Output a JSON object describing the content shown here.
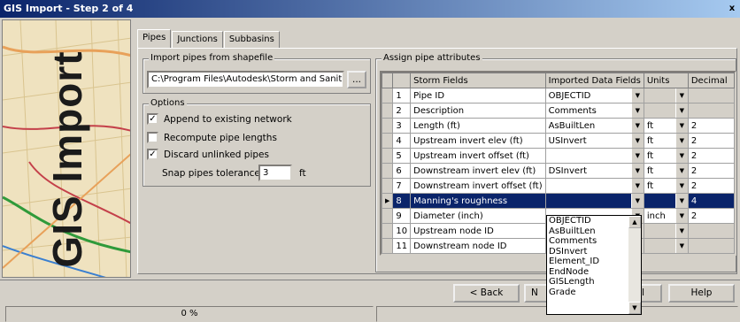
{
  "window": {
    "title": "GIS Import - Step 2 of 4",
    "close_glyph": "x"
  },
  "sidebar": {
    "brand": "GIS Import"
  },
  "tabs": [
    "Pipes",
    "Junctions",
    "Subbasins"
  ],
  "import_group": {
    "title": "Import pipes from shapefile",
    "path": "C:\\Program Files\\Autodesk\\Storm and Sanit",
    "browse_label": "..."
  },
  "options": {
    "title": "Options",
    "append_label": "Append to existing network",
    "append_checked": true,
    "recompute_label": "Recompute pipe lengths",
    "recompute_checked": false,
    "discard_label": "Discard unlinked pipes",
    "discard_checked": true,
    "snap_label": "Snap pipes tolerance:",
    "snap_value": "3",
    "snap_unit": "ft"
  },
  "assign": {
    "title": "Assign pipe attributes",
    "headers": [
      "Storm Fields",
      "Imported Data Fields",
      "Units",
      "Decimal"
    ],
    "rows": [
      {
        "num": "1",
        "field": "Pipe ID",
        "imported": "OBJECTID",
        "units": "",
        "decimal": ""
      },
      {
        "num": "2",
        "field": "Description",
        "imported": "Comments",
        "units": "",
        "decimal": ""
      },
      {
        "num": "3",
        "field": "Length (ft)",
        "imported": "AsBuiltLen",
        "units": "ft",
        "decimal": "2"
      },
      {
        "num": "4",
        "field": "Upstream invert elev (ft)",
        "imported": "USInvert",
        "units": "ft",
        "decimal": "2"
      },
      {
        "num": "5",
        "field": "Upstream invert offset (ft)",
        "imported": "",
        "units": "ft",
        "decimal": "2"
      },
      {
        "num": "6",
        "field": "Downstream invert elev (ft)",
        "imported": "DSInvert",
        "units": "ft",
        "decimal": "2"
      },
      {
        "num": "7",
        "field": "Downstream invert offset (ft)",
        "imported": "",
        "units": "ft",
        "decimal": "2"
      },
      {
        "num": "8",
        "field": "Manning's roughness",
        "imported": "",
        "units": "",
        "decimal": "4"
      },
      {
        "num": "9",
        "field": "Diameter (inch)",
        "imported": "",
        "units": "inch",
        "decimal": "2"
      },
      {
        "num": "10",
        "field": "Upstream node ID",
        "imported": "",
        "units": "",
        "decimal": ""
      },
      {
        "num": "11",
        "field": "Downstream node ID",
        "imported": "",
        "units": "",
        "decimal": ""
      }
    ],
    "selected_row": 7
  },
  "dropdown_list": [
    "OBJECTID",
    "AsBuiltLen",
    "Comments",
    "DSInvert",
    "Element_ID",
    "EndNode",
    "GISLength",
    "Grade"
  ],
  "buttons": {
    "back": "< Back",
    "next": "N",
    "cancel": "ncel",
    "help": "Help"
  },
  "status": {
    "progress_text": "0 %",
    "progress": 0
  }
}
